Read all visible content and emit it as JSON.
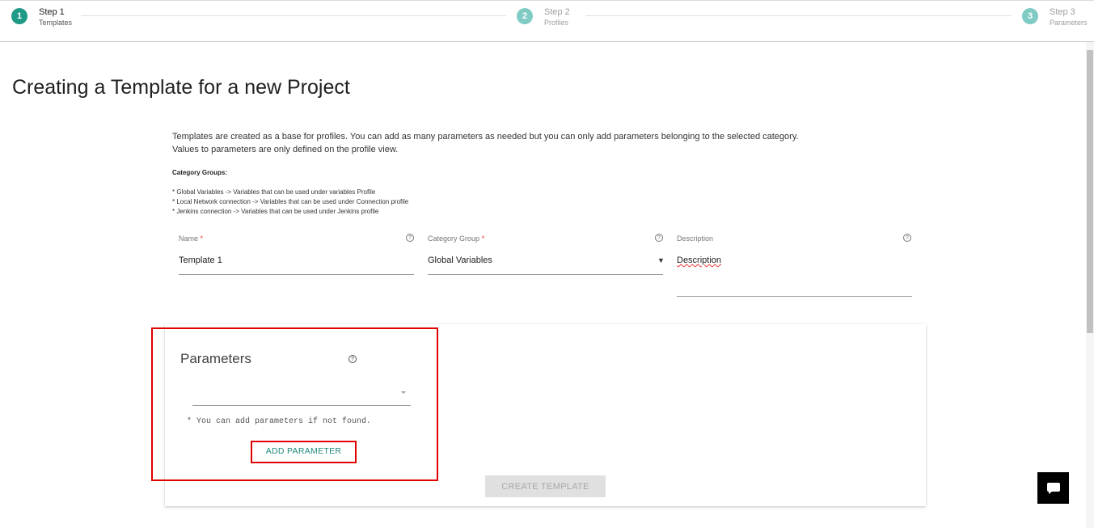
{
  "stepper": {
    "steps": [
      {
        "number": "1",
        "title": "Step 1",
        "subtitle": "Templates"
      },
      {
        "number": "2",
        "title": "Step 2",
        "subtitle": "Profiles"
      },
      {
        "number": "3",
        "title": "Step 3",
        "subtitle": "Parameters"
      }
    ],
    "active_step": 1
  },
  "page": {
    "title": "Creating a Template for a new Project",
    "intro_line1": "Templates are created as a base for profiles. You can add as many parameters as needed but you can only add parameters belonging to the selected category.",
    "intro_line2": "Values to parameters are only defined on the profile view.",
    "category_heading": "Category Groups:",
    "category_items": [
      "* Global Variables -> Variables that can be used under variables Profile",
      "* Local Network connection -> Variables that can be used under Connection profile",
      "* Jenkins connection -> Variables that can be used under Jenkins profile"
    ]
  },
  "form": {
    "name_label": "Name",
    "name_value": "Template 1",
    "category_label": "Category Group",
    "category_value": "Global Variables",
    "description_label": "Description",
    "description_value": "Description",
    "required_mark": "*",
    "help_glyph": "?"
  },
  "parameters": {
    "title": "Parameters",
    "help_glyph": "?",
    "note": "* You can add parameters if not found.",
    "add_button": "ADD PARAMETER",
    "create_button": "CREATE TEMPLATE"
  },
  "colors": {
    "accent": "#1e9a87",
    "accent_light": "#80cbc4",
    "highlight": "#e00000"
  }
}
